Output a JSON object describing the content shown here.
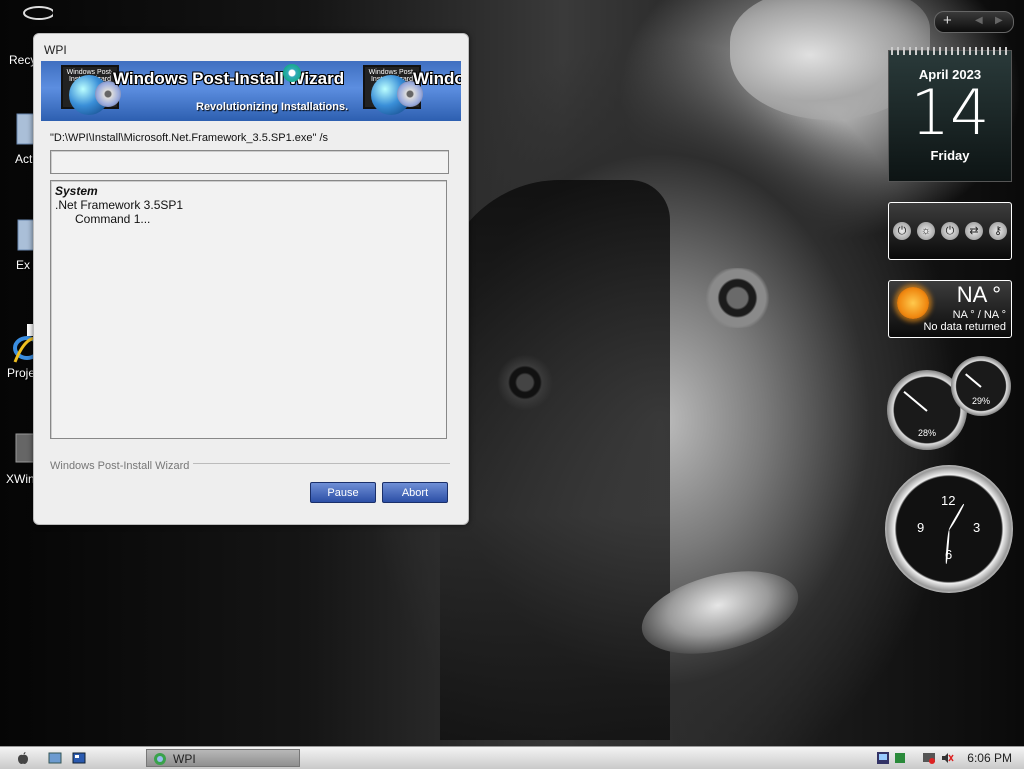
{
  "desktop": {
    "icons": [
      {
        "label": "Recy"
      },
      {
        "label": "Act"
      },
      {
        "label": "Ex"
      },
      {
        "label": "Proje"
      },
      {
        "label": "XWin"
      }
    ]
  },
  "window": {
    "title": "WPI",
    "banner": {
      "title": "Windows Post-Install Wizard",
      "title_repeat": "Windo",
      "tagline": "Revolutionizing Installations.",
      "laptop_caption": "Windows Post-Install Wizard"
    },
    "command": "\"D:\\WPI\\Install\\Microsoft.Net.Framework_3.5.SP1.exe\" /s",
    "progress": 0,
    "log": {
      "category": "System",
      "item": ".Net Framework 3.5SP1",
      "status": "Command 1..."
    },
    "footer_label": "Windows Post-Install Wizard",
    "pause_label": "Pause",
    "abort_label": "Abort"
  },
  "gadgets": {
    "add_symbol": "+",
    "calendar": {
      "month": "April 2023",
      "day": "14",
      "weekday": "Friday"
    },
    "weather": {
      "temp": "NA °",
      "range": "NA ° / NA °",
      "message": "No data returned"
    },
    "cpu_meter": {
      "large": "28%",
      "small": "29%"
    },
    "clock": {
      "n12": "12",
      "n3": "3",
      "n6": "6",
      "n9": "9"
    }
  },
  "taskbar": {
    "task_label": "WPI",
    "time": "6:06 PM"
  }
}
